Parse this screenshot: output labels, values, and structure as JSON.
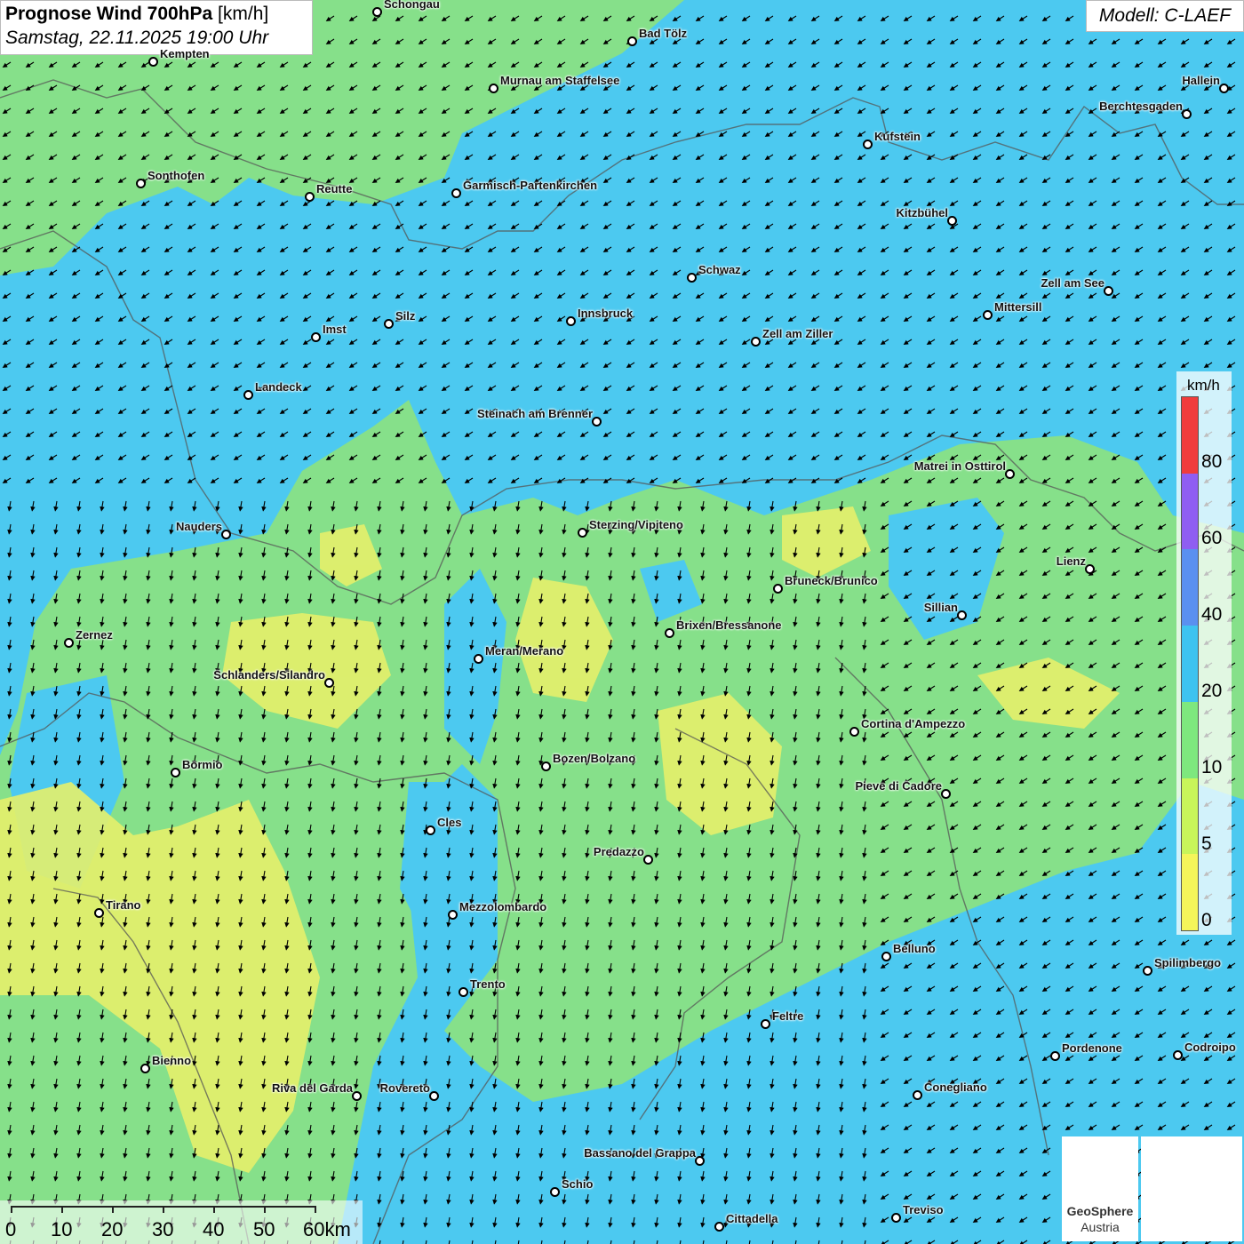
{
  "title": {
    "main_bold": "Prognose Wind 700hPa",
    "unit": "[km/h]",
    "datetime": "Samstag, 22.11.2025 19:00 Uhr"
  },
  "model": "Modell: C-LAEF",
  "legend": {
    "unit": "km/h",
    "labels": [
      "80",
      "60",
      "40",
      "20",
      "10",
      "5",
      "0"
    ],
    "colors": [
      "#f03c3c",
      "#8f5ef2",
      "#5a90f0",
      "#3ec3f0",
      "#7ee87e",
      "#c8f55a",
      "#f5f55a"
    ]
  },
  "scalebar": {
    "labels": [
      "0",
      "10",
      "20",
      "30",
      "40",
      "50",
      "60km"
    ]
  },
  "logos": {
    "geosphere_line1": "GeoSphere",
    "geosphere_line2": "Austria"
  },
  "wind_direction": "south-west",
  "cities": [
    {
      "name": "Schongau"
    },
    {
      "name": "Bad Tölz"
    },
    {
      "name": "Kempten"
    },
    {
      "name": "Murnau am Staffelsee"
    },
    {
      "name": "Hallein"
    },
    {
      "name": "Berchtesgaden"
    },
    {
      "name": "Kufstein"
    },
    {
      "name": "Sonthofen"
    },
    {
      "name": "Reutte"
    },
    {
      "name": "Garmisch-Partenkirchen"
    },
    {
      "name": "Kitzbühel"
    },
    {
      "name": "Schwaz"
    },
    {
      "name": "Zell am See"
    },
    {
      "name": "Mittersill"
    },
    {
      "name": "Imst"
    },
    {
      "name": "Silz"
    },
    {
      "name": "Innsbruck"
    },
    {
      "name": "Zell am Ziller"
    },
    {
      "name": "Landeck"
    },
    {
      "name": "Steinach am Brenner"
    },
    {
      "name": "Matrei in Osttirol"
    },
    {
      "name": "Nauders"
    },
    {
      "name": "Sterzing/Vipiteno"
    },
    {
      "name": "Lienz"
    },
    {
      "name": "Bruneck/Brunico"
    },
    {
      "name": "Sillian"
    },
    {
      "name": "Brixen/Bressanone"
    },
    {
      "name": "Zernez"
    },
    {
      "name": "Meran/Merano"
    },
    {
      "name": "Schlanders/Silandro"
    },
    {
      "name": "Cortina d'Ampezzo"
    },
    {
      "name": "Bozen/Bolzano"
    },
    {
      "name": "Bormio"
    },
    {
      "name": "Pieve di Cadore"
    },
    {
      "name": "Cles"
    },
    {
      "name": "Predazzo"
    },
    {
      "name": "Tirano"
    },
    {
      "name": "Mezzolombardo"
    },
    {
      "name": "Belluno"
    },
    {
      "name": "Spilimbergo"
    },
    {
      "name": "Trento"
    },
    {
      "name": "Feltre"
    },
    {
      "name": "Pordenone"
    },
    {
      "name": "Codroipo"
    },
    {
      "name": "Bienno"
    },
    {
      "name": "Riva del Garda"
    },
    {
      "name": "Rovereto"
    },
    {
      "name": "Conegliano"
    },
    {
      "name": "Bassano del Grappa"
    },
    {
      "name": "Schio"
    },
    {
      "name": "Treviso"
    },
    {
      "name": "Cittadella"
    }
  ]
}
